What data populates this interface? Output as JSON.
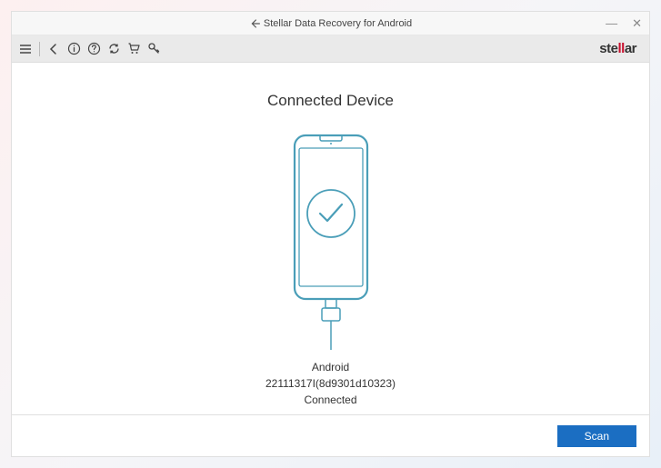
{
  "window": {
    "title": "Stellar Data Recovery for Android"
  },
  "brand": {
    "prefix": "ste",
    "accent": "ll",
    "suffix": "ar"
  },
  "content": {
    "heading": "Connected Device",
    "device_name": "Android",
    "device_id": "22111317I(8d9301d10323)",
    "status": "Connected"
  },
  "buttons": {
    "scan": "Scan"
  },
  "colors": {
    "phone_stroke": "#4a9eb8",
    "accent_red": "#c8102e",
    "button_blue": "#1b6ec2"
  }
}
